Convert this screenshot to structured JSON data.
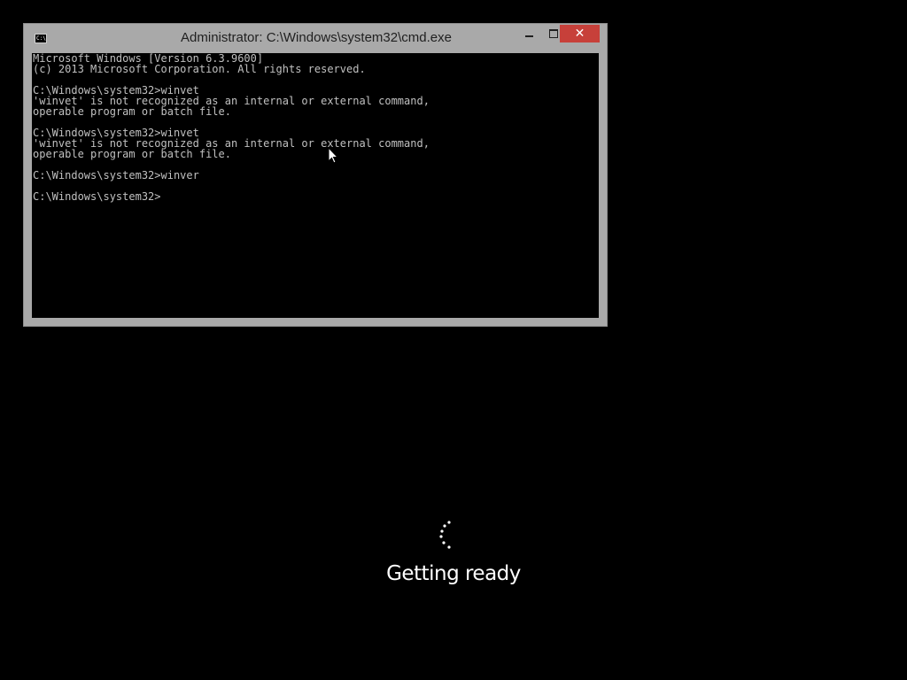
{
  "window": {
    "title": "Administrator: C:\\Windows\\system32\\cmd.exe",
    "icon": "cmd-app-icon",
    "icon_label": "C:\\",
    "controls": {
      "minimize_icon": "minimize-icon",
      "maximize_icon": "maximize-icon",
      "close_icon": "close-icon",
      "close_glyph": "✕",
      "close_color": "#c7403a"
    },
    "frame_color": "#a9a9a9"
  },
  "console": {
    "background": "#000000",
    "foreground": "#c0c0c0",
    "lines": [
      "Microsoft Windows [Version 6.3.9600]",
      "(c) 2013 Microsoft Corporation. All rights reserved.",
      "",
      "C:\\Windows\\system32>winvet",
      "'winvet' is not recognized as an internal or external command,",
      "operable program or batch file.",
      "",
      "C:\\Windows\\system32>winvet",
      "'winvet' is not recognized as an internal or external command,",
      "operable program or batch file.",
      "",
      "C:\\Windows\\system32>winver",
      "",
      "C:\\Windows\\system32>"
    ]
  },
  "pointer": {
    "icon": "mouse-pointer-icon"
  },
  "status": {
    "icon": "loading-spinner-icon",
    "text": "Getting ready"
  }
}
